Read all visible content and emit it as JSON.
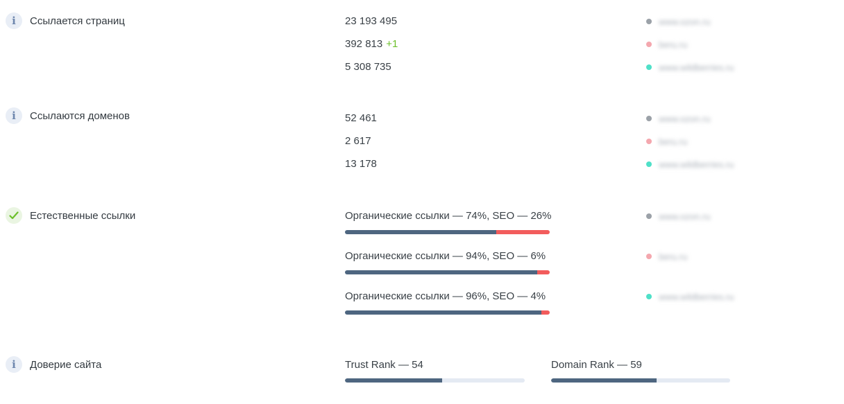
{
  "metrics": [
    {
      "icon": "info",
      "label": "Ссылается страниц",
      "rows": [
        {
          "value": "23 193 495",
          "delta": "",
          "domain": "www.ozon.ru",
          "dot_color": "#9ba1a8"
        },
        {
          "value": "392 813",
          "delta": "+1",
          "domain": "beru.ru",
          "dot_color": "#f4a7ae"
        },
        {
          "value": "5 308 735",
          "delta": "",
          "domain": "www.wildberries.ru",
          "dot_color": "#4fe0c8"
        }
      ]
    },
    {
      "icon": "info",
      "label": "Ссылаются доменов",
      "rows": [
        {
          "value": "52 461",
          "domain": "www.ozon.ru",
          "dot_color": "#9ba1a8"
        },
        {
          "value": "2 617",
          "domain": "beru.ru",
          "dot_color": "#f4a7ae"
        },
        {
          "value": "13 178",
          "domain": "www.wildberries.ru",
          "dot_color": "#4fe0c8"
        }
      ]
    }
  ],
  "natural_links": {
    "icon": "check",
    "label": "Естественные ссылки",
    "rows": [
      {
        "text": "Органические ссылки — 74%, SEO — 26%",
        "organic_pct": 74,
        "seo_pct": 26,
        "domain": "www.ozon.ru",
        "dot_color": "#9ba1a8"
      },
      {
        "text": "Органические ссылки — 94%, SEO — 6%",
        "organic_pct": 94,
        "seo_pct": 6,
        "domain": "beru.ru",
        "dot_color": "#f4a7ae"
      },
      {
        "text": "Органические ссылки — 96%, SEO — 4%",
        "organic_pct": 96,
        "seo_pct": 4,
        "domain": "www.wildberries.ru",
        "dot_color": "#4fe0c8"
      }
    ]
  },
  "trust": {
    "icon": "info",
    "label": "Доверие сайта",
    "trust_rank": {
      "text": "Trust Rank — 54",
      "value": 54
    },
    "domain_rank": {
      "text": "Domain Rank — 59",
      "value": 59
    }
  },
  "colors": {
    "organic": "#4e6680",
    "seo": "#f25c5c",
    "track": "#e4eaf3",
    "delta": "#6cbf2a"
  }
}
